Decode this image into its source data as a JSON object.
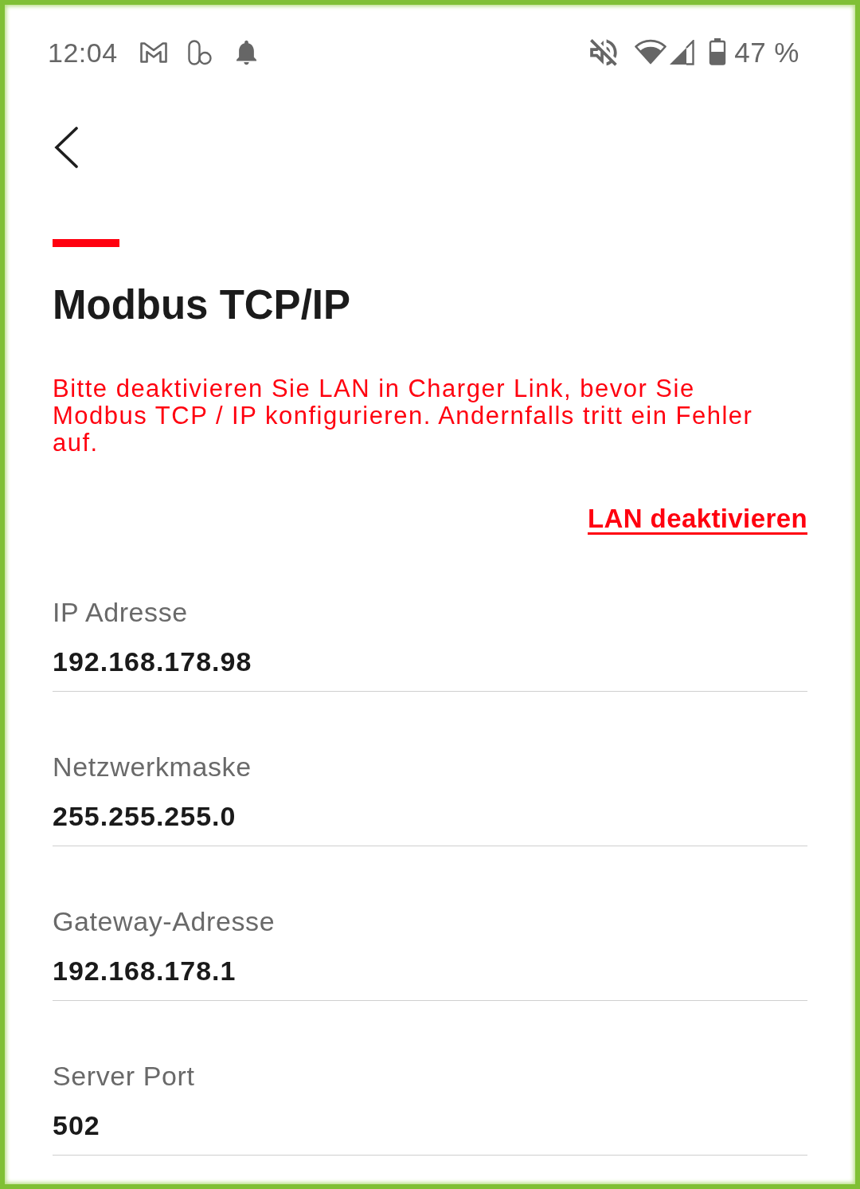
{
  "status_bar": {
    "time": "12:04",
    "battery_percent": "47 %"
  },
  "header": {
    "title": "Modbus TCP/IP"
  },
  "warning": "Bitte deaktivieren Sie LAN in Charger Link, bevor Sie Modbus TCP / IP konfigurieren. Andernfalls tritt ein Fehler auf.",
  "action_link": "LAN deaktivieren",
  "fields": [
    {
      "label": "IP Adresse",
      "value": "192.168.178.98"
    },
    {
      "label": "Netzwerkmaske",
      "value": "255.255.255.0"
    },
    {
      "label": "Gateway-Adresse",
      "value": "192.168.178.1"
    },
    {
      "label": "Server Port",
      "value": "502"
    }
  ]
}
